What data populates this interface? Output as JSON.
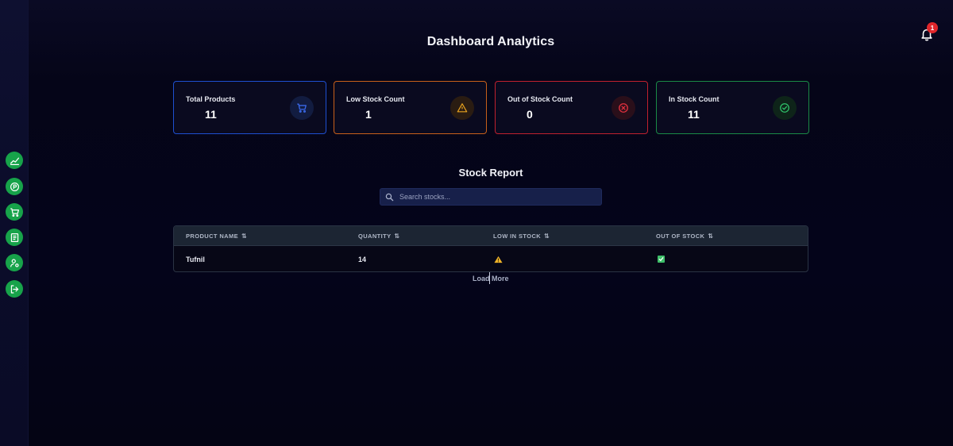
{
  "header": {
    "title": "Dashboard Analytics"
  },
  "notifications": {
    "count": "1",
    "icon": "bell-icon"
  },
  "sidebar": {
    "items": [
      {
        "name": "analytics",
        "icon": "chart-line-icon"
      },
      {
        "name": "products",
        "icon": "product-icon"
      },
      {
        "name": "cart",
        "icon": "cart-icon"
      },
      {
        "name": "reports",
        "icon": "report-icon"
      },
      {
        "name": "users",
        "icon": "user-settings-icon"
      },
      {
        "name": "logout",
        "icon": "logout-icon"
      }
    ],
    "accent": "#17a34a"
  },
  "cards": [
    {
      "label": "Total Products",
      "value": "11",
      "border": "#1e4fd0",
      "icon": "cart-icon",
      "icon_color": "#3a68e8"
    },
    {
      "label": "Low Stock Count",
      "value": "1",
      "border": "#c8601a",
      "icon": "warning-icon",
      "icon_color": "#e8a21f"
    },
    {
      "label": "Out of Stock Count",
      "value": "0",
      "border": "#c0202e",
      "icon": "x-circle-icon",
      "icon_color": "#e2303e"
    },
    {
      "label": "In Stock Count",
      "value": "11",
      "border": "#1a8a46",
      "icon": "check-circle-icon",
      "icon_color": "#2fbf68"
    }
  ],
  "report": {
    "title": "Stock Report",
    "search": {
      "placeholder": "Search stocks...",
      "value": ""
    },
    "columns": [
      "PRODUCT NAME",
      "QUANTITY",
      "LOW IN STOCK",
      "OUT OF STOCK"
    ],
    "sort_icon": "⇅",
    "rows": [
      {
        "product": "Tufnil",
        "quantity": "14",
        "low_in_stock": "warning-icon",
        "out_of_stock": "checked-checkbox"
      }
    ],
    "load_more": "Load More"
  }
}
